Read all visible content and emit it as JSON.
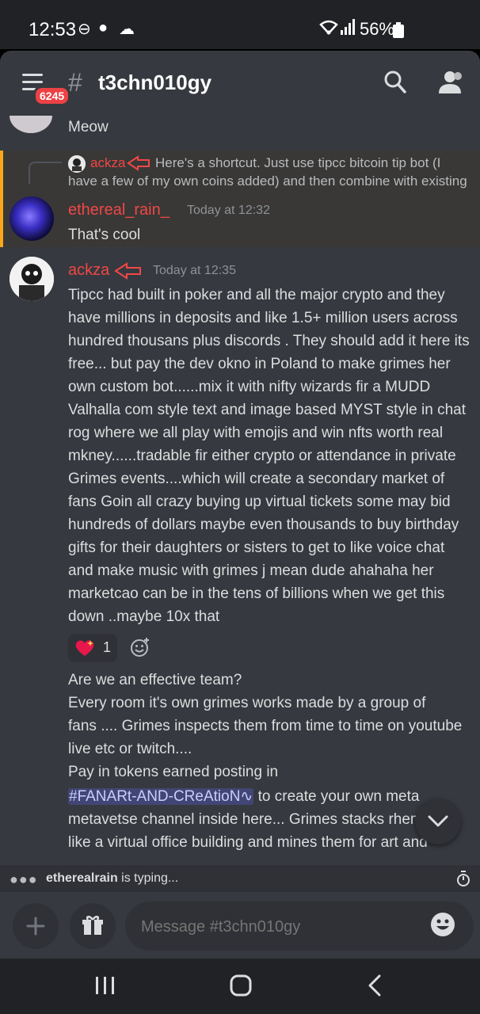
{
  "status_bar": {
    "time": "12:53",
    "battery": "56%"
  },
  "header": {
    "notification_badge": "6245",
    "channel_name": "t3chn010gy"
  },
  "messages": {
    "prev_message_text": "Meow",
    "reply": {
      "reply_to_user": "ackza",
      "reply_preview_line1": "Here's a shortcut. Just use tipcc bitcoin tip bot (I",
      "reply_preview_line2": "have a few of my own coins added) and then combine with existing",
      "author": "ethereal_rain_",
      "timestamp": "Today at 12:32",
      "text": "That's cool"
    },
    "main": {
      "author": "ackza",
      "timestamp": "Today at 12:35",
      "lines": [
        "Tipcc had built in poker and all the major crypto and they",
        "have millions in deposits and like 1.5+ million users across",
        "hundred thousans plus discords . They should add it here its",
        "free... but pay the dev okno in Poland to make grimes her",
        "own custom bot......mix it with nifty wizards fir a MUDD",
        "Valhalla com style text and image based MYST style in chat",
        "rog where we all play with emojis and win nfts worth real",
        "mkney......tradable fir either crypto or attendance in private",
        "Grimes events....which will create a secondary market of",
        "fans Goin all crazy buying up virtual tickets some may bid",
        "hundreds of dollars maybe even thousands to buy birthday",
        "gifts for their daughters or sisters to get to like voice chat",
        "and make music with grimes j mean dude ahahaha her",
        "marketcao can be in the tens of billions when we get this",
        "down ..maybe 10x that"
      ],
      "reaction_count": "1"
    },
    "followup": {
      "line1": "Are we an effective team?",
      "line2": "Every room it's own grimes works made by a group of",
      "line3": "fans .... Grimes inspects them from time to time on youtube",
      "line4": "live etc or twitch....",
      "line5": "Pay in tokens earned posting in",
      "channel_mention": "#FANARt-AND-CReAtioN∿",
      "line6_rest": " to create your own meta",
      "line7": "metavetse channel inside here... Grimes stacks rhem",
      "line8": "like a virtual office building and mines them for art and"
    }
  },
  "typing": {
    "user": "etherealrain",
    "suffix": " is typing..."
  },
  "composer": {
    "placeholder": "Message #t3chn010gy"
  },
  "colors": {
    "background": "#36393f",
    "username_red": "#f04747",
    "reply_highlight_border": "#faa61a",
    "mention_bg": "#414675"
  }
}
